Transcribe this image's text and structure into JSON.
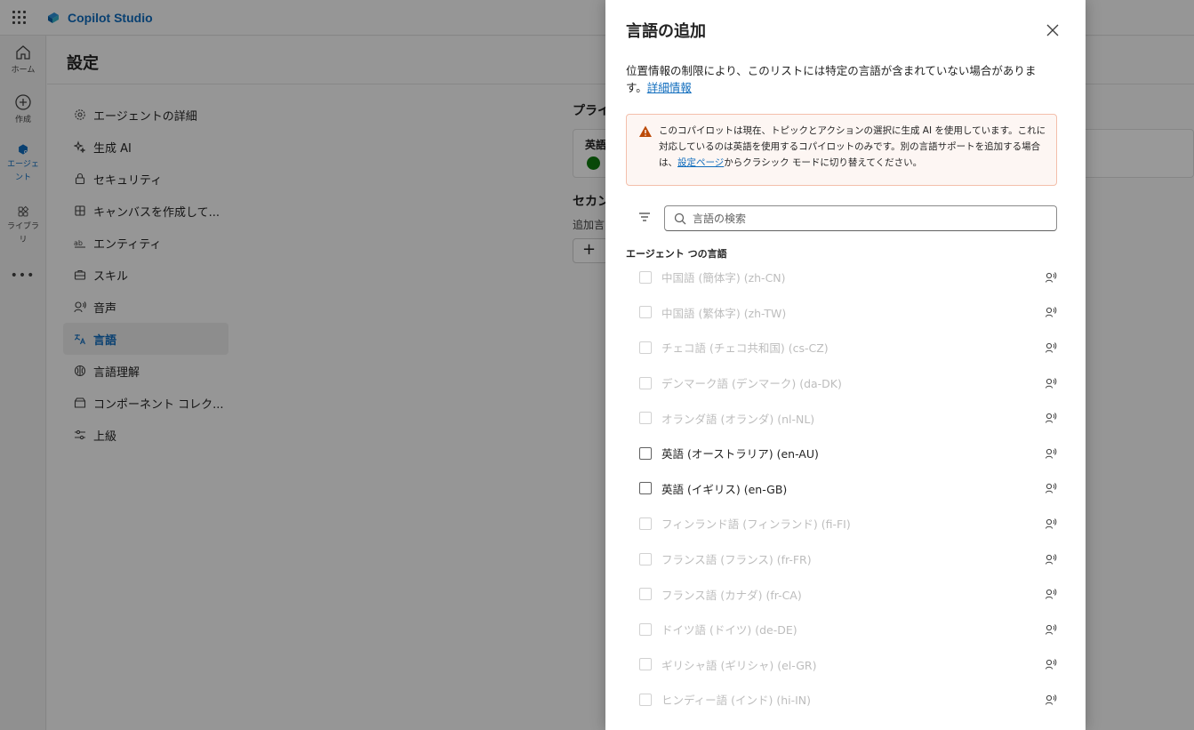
{
  "app": {
    "name": "Copilot Studio"
  },
  "rail": {
    "items": [
      {
        "label": "ホーム",
        "icon": "home-icon"
      },
      {
        "label": "作成",
        "icon": "plus-circle-icon"
      },
      {
        "label": "エージェント",
        "icon": "agent-icon",
        "active": true
      },
      {
        "label": "ライブラリ",
        "icon": "library-icon"
      }
    ],
    "more": "•••"
  },
  "page": {
    "title": "設定",
    "nav": [
      {
        "label": "エージェントの詳細",
        "icon": "gear-icon"
      },
      {
        "label": "生成 AI",
        "icon": "sparkle-icon"
      },
      {
        "label": "セキュリティ",
        "icon": "lock-icon"
      },
      {
        "label": "キャンバスを作成して...",
        "icon": "grid-icon"
      },
      {
        "label": "エンティティ",
        "icon": "ab-icon"
      },
      {
        "label": "スキル",
        "icon": "briefcase-icon"
      },
      {
        "label": "音声",
        "icon": "voice-icon"
      },
      {
        "label": "言語",
        "icon": "translate-icon",
        "active": true
      },
      {
        "label": "言語理解",
        "icon": "brain-icon"
      },
      {
        "label": "コンポーネント コレク...",
        "icon": "box-icon"
      },
      {
        "label": "上級",
        "icon": "sliders-icon"
      }
    ],
    "primary_heading": "プライ",
    "primary_lang": "英語",
    "secondary_heading": "セカン",
    "secondary_sub": "追加言",
    "add_label": "+"
  },
  "panel": {
    "title": "言語の追加",
    "desc_text": "位置情報の制限により、このリストには特定の言語が含まれていない場合があります。",
    "desc_link": "詳細情報",
    "warning": {
      "text_before": "このコパイロットは現在、トピックとアクションの選択に生成 AI を使用しています。これに対応しているのは英語を使用するコパイロットのみです。別の言語サポートを追加する場合は、",
      "link": "設定ページ",
      "text_after": "からクラシック モードに切り替えてください。"
    },
    "search_placeholder": "言語の検索",
    "list_heading": "エージェント つの言語",
    "languages": [
      {
        "name": "中国語 (簡体字) (zh-CN)",
        "enabled": false
      },
      {
        "name": "中国語 (繁体字) (zh-TW)",
        "enabled": false
      },
      {
        "name": "チェコ語 (チェコ共和国) (cs-CZ)",
        "enabled": false
      },
      {
        "name": "デンマーク語 (デンマーク) (da-DK)",
        "enabled": false
      },
      {
        "name": "オランダ語 (オランダ) (nl-NL)",
        "enabled": false
      },
      {
        "name": "英語 (オーストラリア) (en-AU)",
        "enabled": true
      },
      {
        "name": "英語 (イギリス) (en-GB)",
        "enabled": true
      },
      {
        "name": "フィンランド語 (フィンランド) (fi-FI)",
        "enabled": false
      },
      {
        "name": "フランス語 (フランス) (fr-FR)",
        "enabled": false
      },
      {
        "name": "フランス語 (カナダ) (fr-CA)",
        "enabled": false
      },
      {
        "name": "ドイツ語 (ドイツ) (de-DE)",
        "enabled": false
      },
      {
        "name": "ギリシャ語 (ギリシャ) (el-GR)",
        "enabled": false
      },
      {
        "name": "ヒンディー語 (インド) (hi-IN)",
        "enabled": false
      }
    ]
  },
  "colors": {
    "accent": "#0f6cbd",
    "warning": "#bc4b09",
    "success": "#107c10"
  }
}
